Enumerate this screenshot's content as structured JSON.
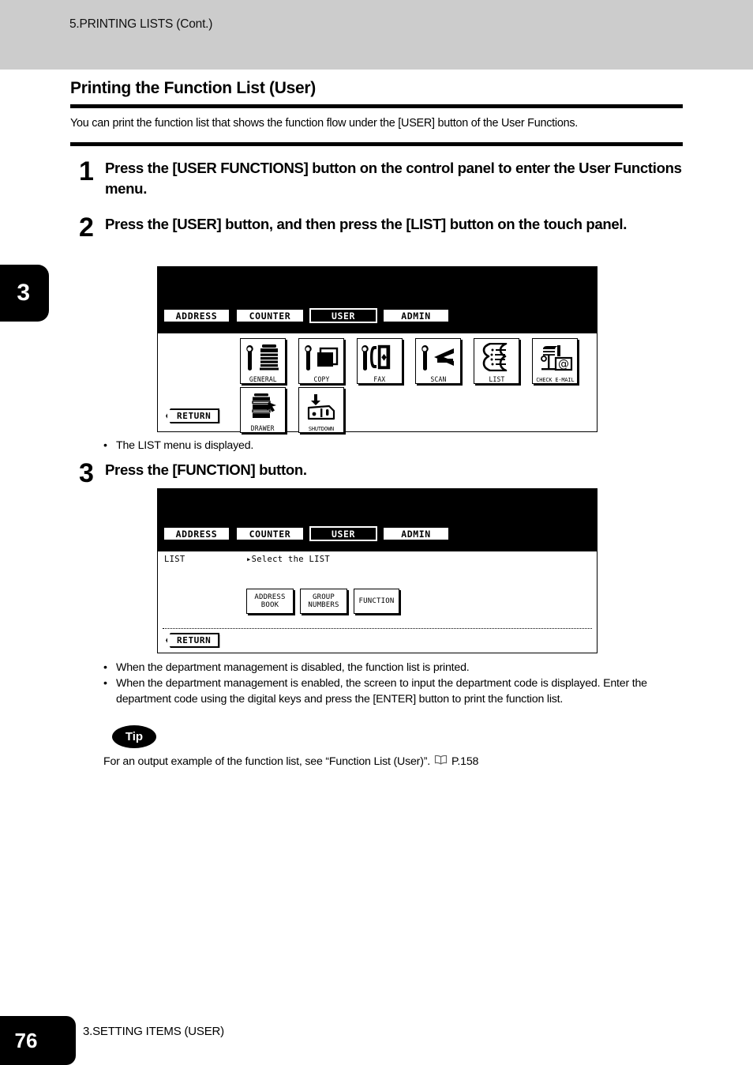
{
  "header": {
    "running_head": "5.PRINTING LISTS (Cont.)"
  },
  "chapter_tab": {
    "number": "3"
  },
  "section": {
    "title": "Printing the Function List (User)",
    "intro": "You can print the function list that shows the function flow under the [USER] button of the User Functions."
  },
  "steps": [
    {
      "number": "1",
      "text": "Press the [USER FUNCTIONS] button on the control panel to enter the User Functions menu."
    },
    {
      "number": "2",
      "text": "Press the [USER] button, and then press the [LIST] button on the touch panel."
    },
    {
      "number": "3",
      "text": "Press the [FUNCTION] button."
    }
  ],
  "panel1": {
    "tabs": [
      {
        "label": "ADDRESS",
        "selected": false
      },
      {
        "label": "COUNTER",
        "selected": false
      },
      {
        "label": "USER",
        "selected": true
      },
      {
        "label": "ADMIN",
        "selected": false
      }
    ],
    "icons_row1": [
      {
        "label": "GENERAL",
        "icon": "wrench-copier-icon"
      },
      {
        "label": "COPY",
        "icon": "wrench-copy-icon"
      },
      {
        "label": "FAX",
        "icon": "wrench-fax-icon"
      },
      {
        "label": "SCAN",
        "icon": "wrench-scan-icon"
      },
      {
        "label": "LIST",
        "icon": "list-scroll-icon"
      },
      {
        "label": "CHECK E-MAIL",
        "icon": "mailbox-at-icon"
      }
    ],
    "icons_row2": [
      {
        "label": "DRAWER",
        "icon": "drawer-printer-icon"
      },
      {
        "label": "SHUTDOWN",
        "icon": "shutdown-icon"
      }
    ],
    "return_label": "RETURN",
    "caption": "The LIST menu is displayed."
  },
  "panel2": {
    "tabs": [
      {
        "label": "ADDRESS",
        "selected": false
      },
      {
        "label": "COUNTER",
        "selected": false
      },
      {
        "label": "USER",
        "selected": true
      },
      {
        "label": "ADMIN",
        "selected": false
      }
    ],
    "screen_name": "LIST",
    "prompt": "Select the LIST",
    "buttons": [
      {
        "line1": "ADDRESS",
        "line2": "BOOK"
      },
      {
        "line1": "GROUP",
        "line2": "NUMBERS"
      },
      {
        "line1": "FUNCTION",
        "line2": ""
      }
    ],
    "return_label": "RETURN"
  },
  "notes": [
    "When the department management is disabled, the function list is printed.",
    "When the department management is enabled, the screen to input the department code is displayed.  Enter the department code using the digital keys and press the [ENTER] button to print the function list."
  ],
  "tip": {
    "badge": "Tip",
    "text": "For an output example of the function list, see “Function List (User)”.",
    "reference": "P.158",
    "icon": "open-book-icon"
  },
  "footer": {
    "page_number": "76",
    "chapter_title": "3.SETTING ITEMS (USER)"
  },
  "bullet_char": "•"
}
